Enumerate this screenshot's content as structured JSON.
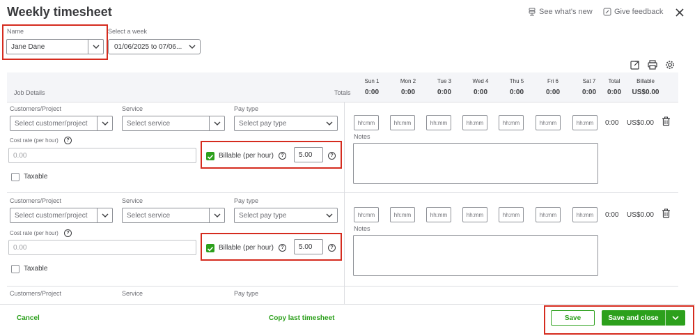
{
  "header": {
    "title": "Weekly timesheet",
    "see_whats_new": "See what's new",
    "give_feedback": "Give feedback"
  },
  "filters": {
    "name_label": "Name",
    "name_value": "Jane Dane",
    "week_label": "Select a week",
    "week_value": "01/06/2025 to 07/06..."
  },
  "grid": {
    "job_details": "Job Details",
    "totals_label": "Totals",
    "days": [
      {
        "name": "Sun 1",
        "value": "0:00"
      },
      {
        "name": "Mon 2",
        "value": "0:00"
      },
      {
        "name": "Tue 3",
        "value": "0:00"
      },
      {
        "name": "Wed 4",
        "value": "0:00"
      },
      {
        "name": "Thu 5",
        "value": "0:00"
      },
      {
        "name": "Fri 6",
        "value": "0:00"
      },
      {
        "name": "Sat 7",
        "value": "0:00"
      }
    ],
    "total_label": "Total",
    "total_value": "0:00",
    "billable_label": "Billable",
    "billable_value": "US$0.00"
  },
  "entries": [
    {
      "customer_label": "Customers/Project",
      "customer_placeholder": "Select customer/project",
      "service_label": "Service",
      "service_placeholder": "Select service",
      "paytype_label": "Pay type",
      "paytype_placeholder": "Select pay type",
      "cost_rate_label": "Cost rate (per hour)",
      "cost_rate_placeholder": "0.00",
      "billable_label": "Billable (per hour)",
      "billable_checked": true,
      "billable_rate": "5.00",
      "taxable_label": "Taxable",
      "time_placeholder": "hh:mm",
      "notes_label": "Notes",
      "row_total": "0:00",
      "row_billable": "US$0.00"
    },
    {
      "customer_label": "Customers/Project",
      "customer_placeholder": "Select customer/project",
      "service_label": "Service",
      "service_placeholder": "Select service",
      "paytype_label": "Pay type",
      "paytype_placeholder": "Select pay type",
      "cost_rate_label": "Cost rate (per hour)",
      "cost_rate_placeholder": "0.00",
      "billable_label": "Billable (per hour)",
      "billable_checked": true,
      "billable_rate": "5.00",
      "taxable_label": "Taxable",
      "time_placeholder": "hh:mm",
      "notes_label": "Notes",
      "row_total": "0:00",
      "row_billable": "US$0.00"
    },
    {
      "customer_label": "Customers/Project",
      "service_label": "Service",
      "paytype_label": "Pay type"
    }
  ],
  "footer": {
    "cancel": "Cancel",
    "copy_last": "Copy last timesheet",
    "save": "Save",
    "save_and_close": "Save and close"
  },
  "colors": {
    "accent_green": "#2ca01c",
    "highlight_red": "#d52b1e",
    "text": "#393a3d"
  }
}
